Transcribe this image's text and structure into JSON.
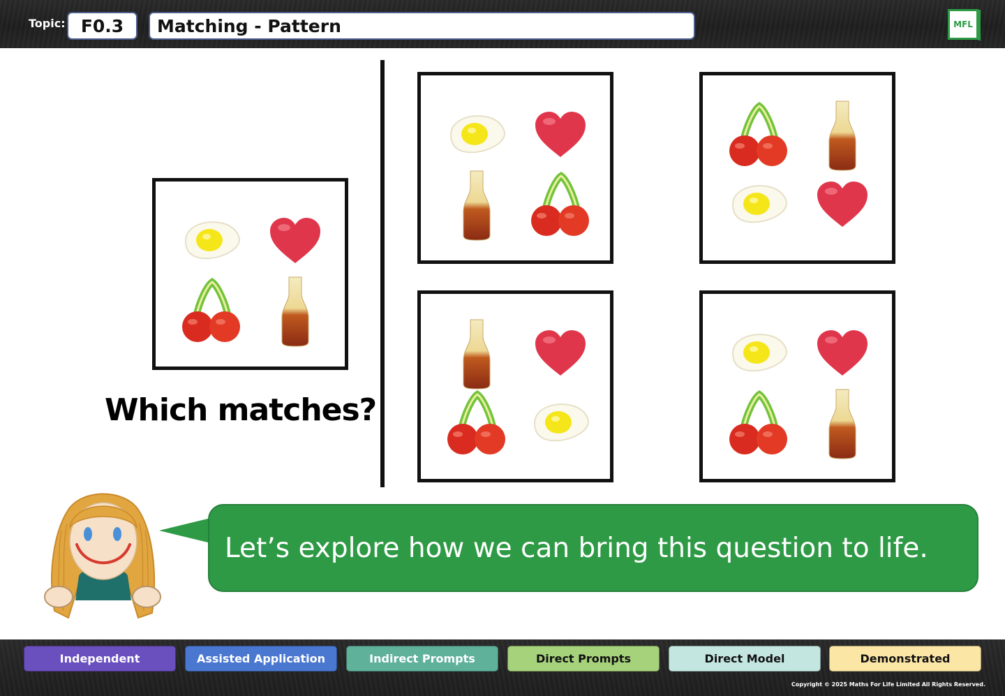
{
  "header": {
    "topic_label": "Topic:",
    "topic_code": "F0.3",
    "topic_title": "Matching - Pattern",
    "logo_text": "MFL"
  },
  "main": {
    "question": "Which matches?",
    "target_card": [
      "egg",
      "heart",
      "cherry",
      "bottle"
    ],
    "options": [
      [
        "egg",
        "heart",
        "bottle",
        "cherry"
      ],
      [
        "cherry",
        "bottle",
        "egg",
        "heart"
      ],
      [
        "bottle",
        "heart",
        "cherry",
        "egg"
      ],
      [
        "egg",
        "heart",
        "cherry",
        "bottle"
      ]
    ]
  },
  "speech": {
    "text": "Let’s explore how we can bring this question to life."
  },
  "levels": [
    {
      "label": "Independent",
      "color": "#6a4fbf",
      "text_color": "#ffffff"
    },
    {
      "label": "Assisted Application",
      "color": "#4a78d0",
      "text_color": "#ffffff"
    },
    {
      "label": "Indirect Prompts",
      "color": "#5fb19a",
      "text_color": "#ffffff"
    },
    {
      "label": "Direct Prompts",
      "color": "#a6d27c",
      "text_color": "#111111"
    },
    {
      "label": "Direct Model",
      "color": "#c4e6e0",
      "text_color": "#111111"
    },
    {
      "label": "Demonstrated",
      "color": "#fce6a6",
      "text_color": "#111111"
    }
  ],
  "footer": {
    "copyright": "Copyright © 2025 Maths For Life Limited All Rights Reserved."
  },
  "colors": {
    "accent_green": "#2e9a45",
    "frame_blue": "#4b5d8c"
  }
}
